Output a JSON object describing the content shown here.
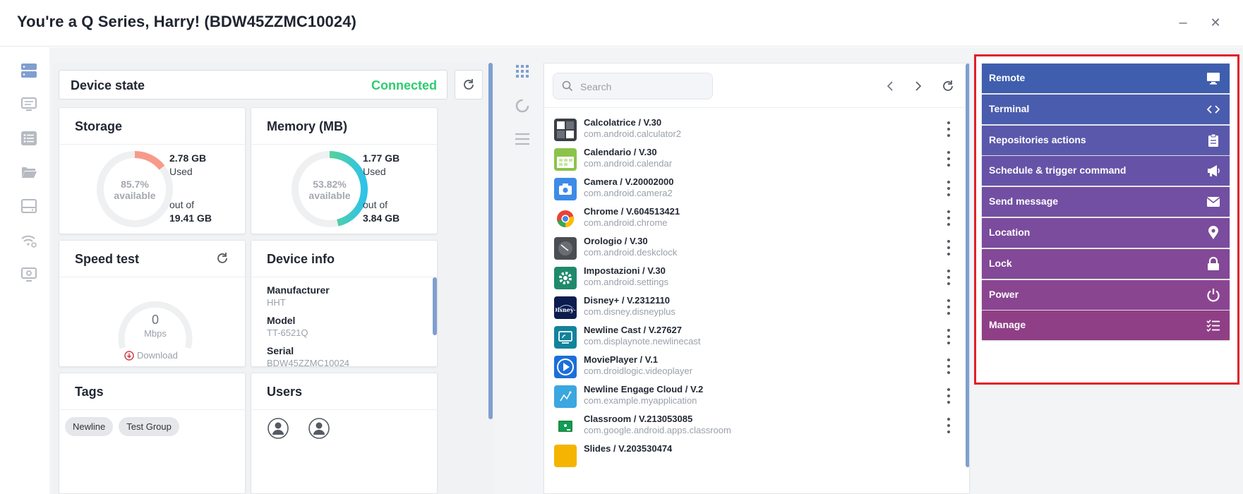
{
  "window": {
    "title": "You're a Q Series, Harry! (BDW45ZZMC10024)",
    "minimize": "–",
    "close": "✕"
  },
  "device_state": {
    "label": "Device state",
    "status": "Connected",
    "status_color": "#2ecc71"
  },
  "storage": {
    "title": "Storage",
    "percent": "85.7%",
    "available_label": "available",
    "used_value": "2.78 GB",
    "used_label": "Used",
    "out_of_label": "out of",
    "total": "19.41 GB",
    "used_fraction": 0.143
  },
  "memory": {
    "title": "Memory (MB)",
    "percent": "53.82%",
    "available_label": "available",
    "used_value": "1.77 GB",
    "used_label": "Used",
    "out_of_label": "out of",
    "total": "3.84 GB",
    "used_fraction": 0.4618
  },
  "speed_test": {
    "title": "Speed test",
    "value": "0",
    "unit": "Mbps",
    "download_label": "Download"
  },
  "device_info": {
    "title": "Device info",
    "fields": [
      {
        "label": "Manufacturer",
        "value": "HHT"
      },
      {
        "label": "Model",
        "value": "TT-6521Q"
      },
      {
        "label": "Serial",
        "value": "BDW45ZZMC10024"
      }
    ]
  },
  "tags": {
    "title": "Tags",
    "items": [
      "Newline",
      "Test Group"
    ]
  },
  "users": {
    "title": "Users"
  },
  "apps": {
    "search_placeholder": "Search",
    "items": [
      {
        "name": "Calcolatrice / V.30",
        "package": "com.android.calculator2",
        "icon": "calculator-icon",
        "color": "#3b3f45"
      },
      {
        "name": "Calendario / V.30",
        "package": "com.android.calendar",
        "icon": "calendar-icon",
        "color": "#8bc34a"
      },
      {
        "name": "Camera / V.20002000",
        "package": "com.android.camera2",
        "icon": "camera-icon",
        "color": "#3d8be8"
      },
      {
        "name": "Chrome / V.604513421",
        "package": "com.android.chrome",
        "icon": "chrome-icon",
        "color": "#ffffff"
      },
      {
        "name": "Orologio / V.30",
        "package": "com.android.deskclock",
        "icon": "clock-icon",
        "color": "#4a4d52"
      },
      {
        "name": "Impostazioni / V.30",
        "package": "com.android.settings",
        "icon": "settings-gear-icon",
        "color": "#1f8a6b"
      },
      {
        "name": "Disney+ / V.2312110",
        "package": "com.disney.disneyplus",
        "icon": "disney-plus-icon",
        "color": "#0b1d4e"
      },
      {
        "name": "Newline Cast / V.27627",
        "package": "com.displaynote.newlinecast",
        "icon": "cast-icon",
        "color": "#12839c"
      },
      {
        "name": "MoviePlayer / V.1",
        "package": "com.droidlogic.videoplayer",
        "icon": "play-icon",
        "color": "#1b6fd9"
      },
      {
        "name": "Newline Engage Cloud / V.2",
        "package": "com.example.myapplication",
        "icon": "engage-cloud-icon",
        "color": "#3ba7e0"
      },
      {
        "name": "Classroom / V.213053085",
        "package": "com.google.android.apps.classroom",
        "icon": "classroom-icon",
        "color": "#ffffff"
      },
      {
        "name": "Slides / V.203530474",
        "package": "",
        "icon": "slides-icon",
        "color": "#f5b400"
      }
    ]
  },
  "actions": [
    {
      "label": "Remote",
      "icon": "monitor-icon",
      "color": "#3f5fae"
    },
    {
      "label": "Terminal",
      "icon": "code-icon",
      "color": "#4a5cad"
    },
    {
      "label": "Repositories actions",
      "icon": "clipboard-icon",
      "color": "#5a58ab"
    },
    {
      "label": "Schedule & trigger command",
      "icon": "megaphone-icon",
      "color": "#6653a7"
    },
    {
      "label": "Send message",
      "icon": "envelope-icon",
      "color": "#724fa2"
    },
    {
      "label": "Location",
      "icon": "map-pin-icon",
      "color": "#7b4b9d"
    },
    {
      "label": "Lock",
      "icon": "lock-icon",
      "color": "#834897"
    },
    {
      "label": "Power",
      "icon": "power-icon",
      "color": "#8a4591"
    },
    {
      "label": "Manage",
      "icon": "checklist-icon",
      "color": "#8f3f86"
    }
  ]
}
